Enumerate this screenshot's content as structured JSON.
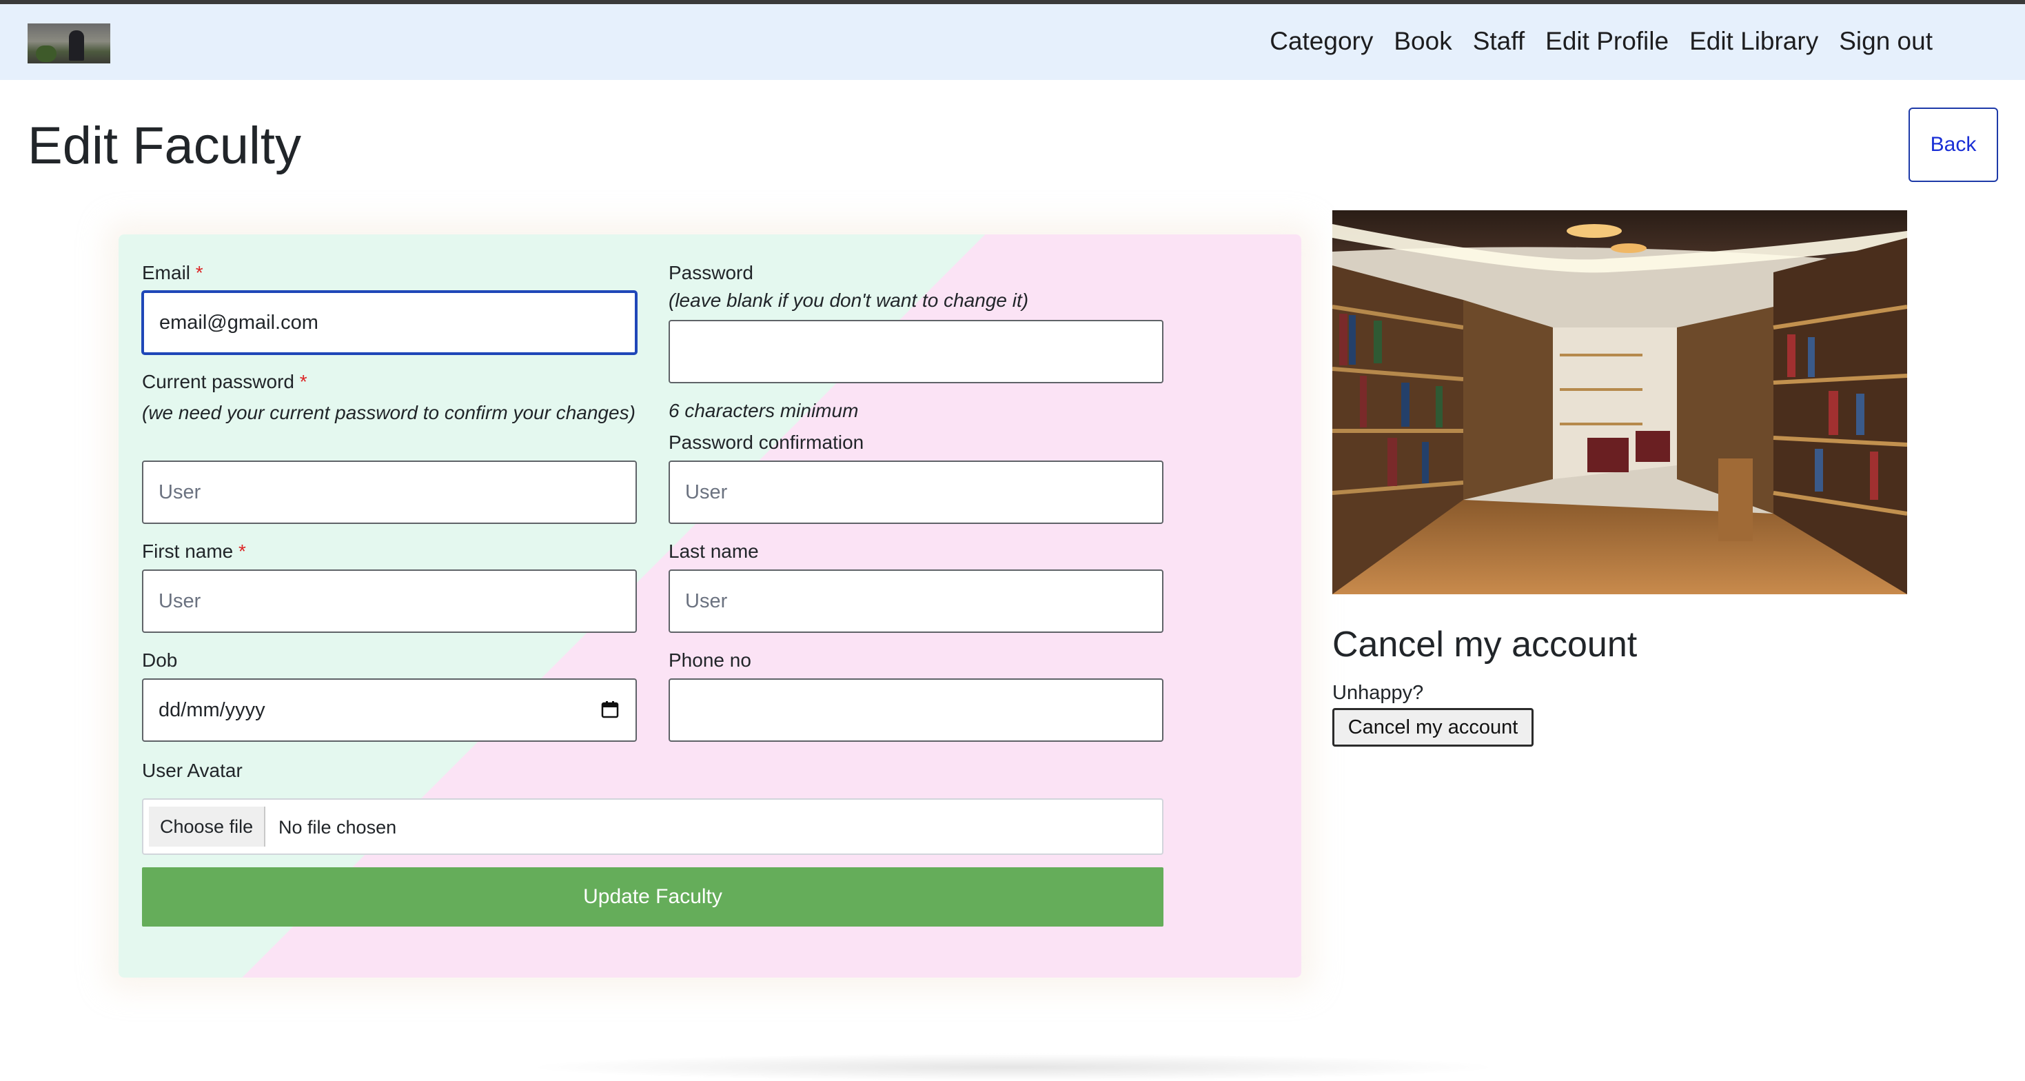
{
  "nav": {
    "links": [
      "Category",
      "Book",
      "Staff",
      "Edit Profile",
      "Edit Library",
      "Sign out"
    ]
  },
  "page": {
    "title": "Edit Faculty",
    "back_label": "Back"
  },
  "form": {
    "email": {
      "label": "Email",
      "required": "*",
      "value": "email@gmail.com"
    },
    "password": {
      "label": "Password",
      "hint": "(leave blank if you don't want to change it)",
      "value": "",
      "min_hint": "6 characters minimum"
    },
    "current_password": {
      "label": "Current password",
      "required": "*",
      "hint": "(we need your current password to confirm your changes)",
      "placeholder": "User"
    },
    "password_confirmation": {
      "label": "Password confirmation",
      "placeholder": "User"
    },
    "first_name": {
      "label": "First name",
      "required": "*",
      "placeholder": "User"
    },
    "last_name": {
      "label": "Last name",
      "placeholder": "User"
    },
    "dob": {
      "label": "Dob",
      "value": "dd/mm/yyyy",
      "icon": "calendar-icon"
    },
    "phone": {
      "label": "Phone no",
      "value": ""
    },
    "avatar": {
      "label": "User Avatar",
      "button_label": "Choose file",
      "status": "No file chosen"
    },
    "submit_label": "Update Faculty"
  },
  "sidebar": {
    "image_subject": "library bookshelves",
    "cancel_heading": "Cancel my account",
    "cancel_prompt": "Unhappy?",
    "cancel_button": "Cancel my account"
  },
  "colors": {
    "navbar_bg": "#e6f0fc",
    "card_green": "#e4f8ef",
    "card_pink": "#fbe3f5",
    "submit_green": "#65ad5a",
    "back_blue": "#1a2fd6",
    "required_red": "#dc2626"
  }
}
